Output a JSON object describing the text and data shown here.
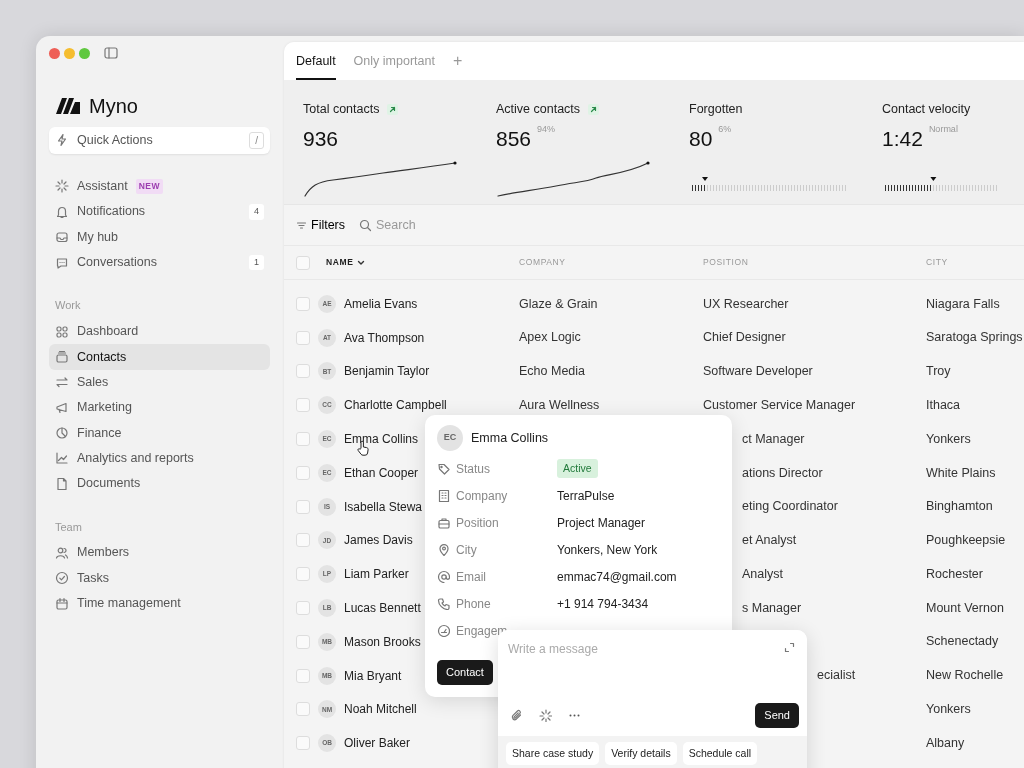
{
  "sidebar": {
    "brand": "Myno",
    "quick_actions": {
      "label": "Quick Actions",
      "shortcut": "/"
    },
    "items": [
      {
        "label": "Assistant",
        "tag": "NEW",
        "selected": false
      },
      {
        "label": "Notifications",
        "count": "4",
        "selected": false
      },
      {
        "label": "My hub",
        "selected": false
      },
      {
        "label": "Conversations",
        "count": "1",
        "selected": false
      }
    ],
    "sections": [
      {
        "title": "Work",
        "items": [
          {
            "label": "Dashboard",
            "selected": false
          },
          {
            "label": "Contacts",
            "selected": true
          },
          {
            "label": "Sales",
            "selected": false
          },
          {
            "label": "Marketing",
            "selected": false
          },
          {
            "label": "Finance",
            "selected": false
          },
          {
            "label": "Analytics and reports",
            "selected": false
          },
          {
            "label": "Documents",
            "selected": false
          }
        ]
      },
      {
        "title": "Team",
        "items": [
          {
            "label": "Members",
            "selected": false
          },
          {
            "label": "Tasks",
            "selected": false
          },
          {
            "label": "Time management",
            "selected": false
          }
        ]
      }
    ]
  },
  "tabs": [
    {
      "label": "Default",
      "selected": true
    },
    {
      "label": "Only important",
      "selected": false
    }
  ],
  "add_tab": "+",
  "stats": [
    {
      "label": "Total contacts",
      "value": "936",
      "trend_up": true,
      "kind": "sparkline"
    },
    {
      "label": "Active contacts",
      "value": "856",
      "note": "94%",
      "trend_up": true,
      "kind": "sparkline"
    },
    {
      "label": "Forgotten",
      "value": "80",
      "note": "6%",
      "kind": "scale",
      "level": 0.08
    },
    {
      "label": "Contact velocity",
      "value": "1:42",
      "note": "Normal",
      "kind": "scale",
      "level": 0.42
    }
  ],
  "toolbar": {
    "filters": "Filters",
    "search_placeholder": "Search"
  },
  "table": {
    "all_checked": false,
    "columns": [
      {
        "label": "NAME",
        "sorted": true
      },
      {
        "label": "COMPANY",
        "sorted": false
      },
      {
        "label": "POSITION",
        "sorted": false
      },
      {
        "label": "CITY",
        "sorted": false
      }
    ],
    "rows": [
      {
        "initials": "AE",
        "name": "Amelia Evans",
        "company": "Glaze & Grain",
        "position": "UX Researcher",
        "city": "Niagara Falls",
        "checked": false
      },
      {
        "initials": "AT",
        "name": "Ava Thompson",
        "company": "Apex Logic",
        "position": "Chief Designer",
        "city": "Saratoga Springs",
        "checked": false
      },
      {
        "initials": "BT",
        "name": "Benjamin Taylor",
        "company": "Echo Media",
        "position": "Software Developer",
        "city": "Troy",
        "checked": false
      },
      {
        "initials": "CC",
        "name": "Charlotte Campbell",
        "company": "Aura Wellness",
        "position": "Customer Service Manager",
        "city": "Ithaca",
        "checked": false
      },
      {
        "initials": "EC",
        "name": "Emma Collins",
        "position": "ct Manager",
        "city": "Yonkers",
        "checked": false
      },
      {
        "initials": "EC",
        "name": "Ethan Cooper",
        "position": "ations Director",
        "city": "White Plains",
        "checked": false
      },
      {
        "initials": "IS",
        "name": "Isabella Stewa",
        "position": "eting Coordinator",
        "city": "Binghamton",
        "checked": false
      },
      {
        "initials": "JD",
        "name": "James Davis",
        "position": "et Analyst",
        "city": "Poughkeepsie",
        "checked": false
      },
      {
        "initials": "LP",
        "name": "Liam Parker",
        "position": "Analyst",
        "city": "Rochester",
        "checked": false
      },
      {
        "initials": "LB",
        "name": "Lucas Bennett",
        "position": "s Manager",
        "city": "Mount Vernon",
        "checked": false
      },
      {
        "initials": "MB",
        "name": "Mason Brooks",
        "city": "Schenectady",
        "checked": false
      },
      {
        "initials": "MB",
        "name": "Mia Bryant",
        "position": "ecialist",
        "city": "New Rochelle",
        "checked": false
      },
      {
        "initials": "NM",
        "name": "Noah Mitchell",
        "city": "Yonkers",
        "checked": false
      },
      {
        "initials": "OB",
        "name": "Oliver Baker",
        "city": "Albany",
        "checked": false
      }
    ]
  },
  "contact_card": {
    "initials": "EC",
    "name": "Emma Collins",
    "fields": [
      {
        "label": "Status",
        "value": "Active",
        "kind": "status"
      },
      {
        "label": "Company",
        "value": "TerraPulse",
        "kind": "text"
      },
      {
        "label": "Position",
        "value": "Project Manager",
        "kind": "text"
      },
      {
        "label": "City",
        "value": "Yonkers, New York",
        "kind": "text"
      },
      {
        "label": "Email",
        "value": "emmac74@gmail.com",
        "kind": "text"
      },
      {
        "label": "Phone",
        "value": "+1 914 794-3434",
        "kind": "text"
      },
      {
        "label": "Engagem"
      }
    ],
    "button": "Contact"
  },
  "composer": {
    "placeholder": "Write a message",
    "send": "Send",
    "suggestions": [
      "Share case study",
      "Verify details",
      "Schedule call"
    ]
  }
}
